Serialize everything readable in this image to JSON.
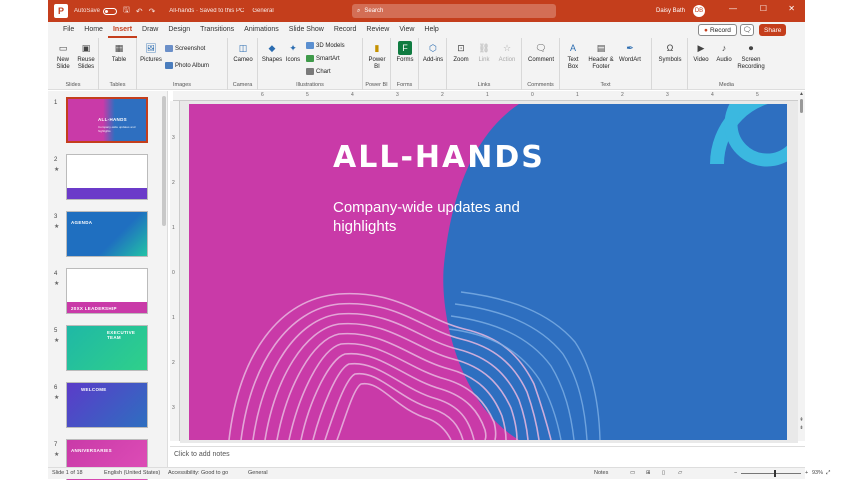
{
  "titlebar": {
    "app_letter": "P",
    "autosave_label": "AutoSave",
    "filename": "All-hands · Saved to this PC",
    "sensitivity": "General",
    "search_placeholder": "Search",
    "user_name": "Daisy Bath",
    "minimize": "—",
    "maximize": "☐",
    "close": "✕"
  },
  "tabs": [
    "File",
    "Home",
    "Insert",
    "Draw",
    "Design",
    "Transitions",
    "Animations",
    "Slide Show",
    "Record",
    "Review",
    "View",
    "Help"
  ],
  "active_tab": "Insert",
  "actions": {
    "record": "Record",
    "share": "Share"
  },
  "ribbon": {
    "slides": {
      "new_slide": "New Slide",
      "reuse_slides": "Reuse Slides",
      "label": "Slides"
    },
    "tables": {
      "table": "Table",
      "label": "Tables"
    },
    "images": {
      "pictures": "Pictures",
      "screenshot": "Screenshot",
      "photo_album": "Photo Album",
      "label": "Images"
    },
    "camera": {
      "cameo": "Cameo",
      "label": "Camera"
    },
    "illustrations": {
      "shapes": "Shapes",
      "icons": "Icons",
      "models_3d": "3D Models",
      "smartart": "SmartArt",
      "chart": "Chart",
      "label": "Illustrations"
    },
    "powerbi": {
      "power_bi": "Power BI",
      "label": "Power BI"
    },
    "forms": {
      "forms": "Forms",
      "label": "Forms"
    },
    "addins": {
      "addins": "Add-ins",
      "label": ""
    },
    "links": {
      "zoom": "Zoom",
      "link": "Link",
      "action": "Action",
      "label": "Links"
    },
    "comments": {
      "comment": "Comment",
      "label": "Comments"
    },
    "text": {
      "text_box": "Text Box",
      "header_footer": "Header & Footer",
      "wordart": "WordArt",
      "label": "Text"
    },
    "symbols": {
      "symbols": "Symbols"
    },
    "media": {
      "video": "Video",
      "audio": "Audio",
      "screen_recording": "Screen Recording",
      "label": "Media"
    }
  },
  "thumbnails": [
    {
      "num": "1",
      "title": "ALL-HANDS",
      "sub": "Company-wide updates and highlights",
      "selected": true
    },
    {
      "num": "2",
      "title": "",
      "sub": "",
      "selected": false
    },
    {
      "num": "3",
      "title": "AGENDA",
      "sub": "",
      "selected": false
    },
    {
      "num": "4",
      "title": "20XX LEADERSHIP",
      "sub": "",
      "selected": false
    },
    {
      "num": "5",
      "title": "EXECUTIVE TEAM",
      "sub": "",
      "selected": false
    },
    {
      "num": "6",
      "title": "WELCOME",
      "sub": "",
      "selected": false
    },
    {
      "num": "7",
      "title": "ANNIVERSARIES",
      "sub": "",
      "selected": false
    }
  ],
  "ruler_top": [
    "6",
    "5",
    "4",
    "3",
    "2",
    "1",
    "0",
    "1",
    "2",
    "3",
    "4",
    "5",
    "6"
  ],
  "ruler_left": [
    "3",
    "2",
    "1",
    "0",
    "1",
    "2",
    "3"
  ],
  "slide": {
    "title": "ALL-HANDS",
    "subtitle": "Company-wide updates and highlights",
    "colors": {
      "pink": "#c93aa8",
      "blue": "#2e6fc0",
      "cyan": "#3bb8e0"
    }
  },
  "notes_placeholder": "Click to add notes",
  "status": {
    "slide_of": "Slide 1 of 18",
    "language": "English (United States)",
    "accessibility": "Accessibility: Good to go",
    "sensitivity": "General",
    "notes": "Notes",
    "zoom": "93%",
    "zoom_level": 0.55
  }
}
